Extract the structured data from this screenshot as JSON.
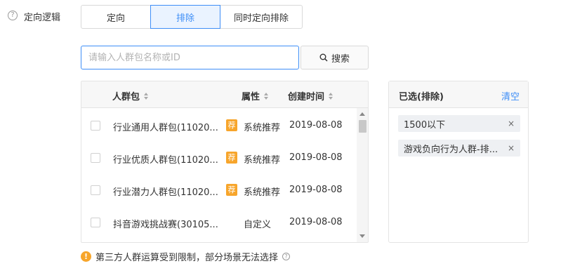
{
  "logic": {
    "help_icon": "?",
    "label": "定向逻辑",
    "options": [
      "定向",
      "排除",
      "同时定向排除"
    ],
    "selected": "排除"
  },
  "search": {
    "placeholder": "请输入人群包名称或ID",
    "value": "",
    "button_label": "搜索",
    "button_icon": "search-icon"
  },
  "table": {
    "columns": [
      "人群包",
      "属性",
      "创建时间"
    ],
    "rows": [
      {
        "name": "行业通用人群包(11020...",
        "tag": "荐",
        "attr": "系统推荐",
        "date": "2019-08-08"
      },
      {
        "name": "行业优质人群包(11020...",
        "tag": "荐",
        "attr": "系统推荐",
        "date": "2019-08-08"
      },
      {
        "name": "行业潜力人群包(11020...",
        "tag": "荐",
        "attr": "系统推荐",
        "date": "2019-08-08"
      },
      {
        "name": "抖音游戏挑战赛(30105...",
        "tag": "",
        "attr": "自定义",
        "date": "2019-08-08"
      }
    ]
  },
  "selected_panel": {
    "title": "已选(排除)",
    "clear_label": "清空",
    "items": [
      "1500以下",
      "游戏负向行为人群-排..."
    ],
    "remove_glyph": "×"
  },
  "notice": {
    "icon": "!",
    "text": "第三方人群运算受到限制，部分场景无法选择",
    "help_icon": "?"
  },
  "colors": {
    "accent": "#3e8ef7",
    "tag": "#f7a52b"
  }
}
